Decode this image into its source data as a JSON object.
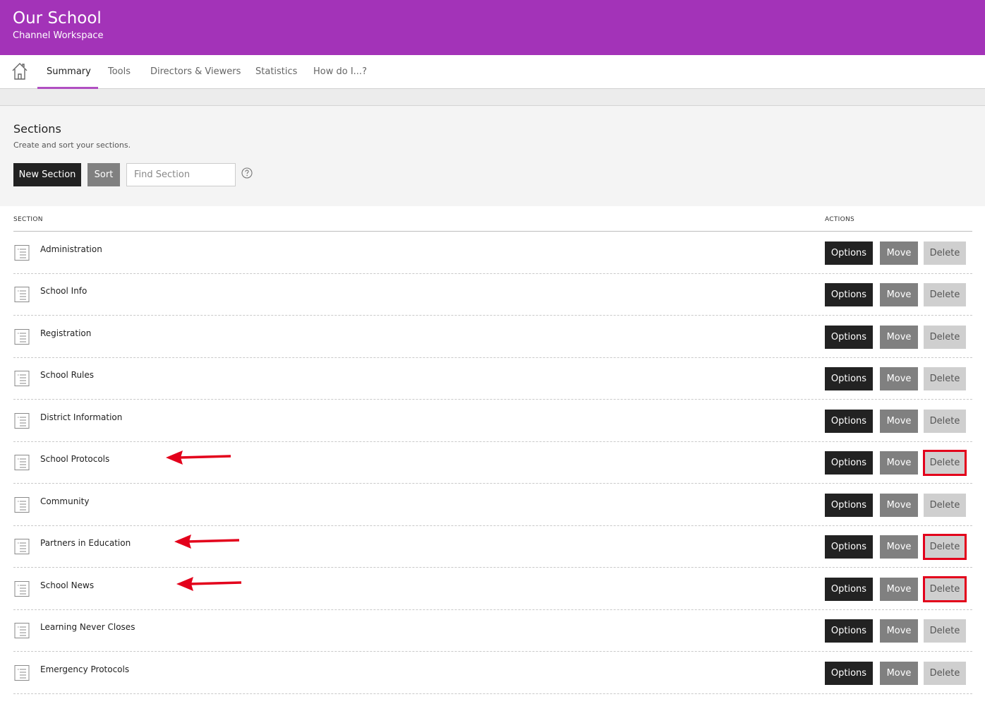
{
  "header": {
    "title": "Our School",
    "subtitle": "Channel Workspace",
    "color": "#a333b8"
  },
  "nav": {
    "home_icon": "home-icon",
    "tabs": [
      "Summary",
      "Tools",
      "Directors & Viewers",
      "Statistics",
      "How do I...?"
    ],
    "active_tab": "Summary"
  },
  "sections_panel": {
    "heading": "Sections",
    "description": "Create and sort your sections.",
    "new_section_label": "New Section",
    "sort_label": "Sort",
    "find_placeholder": "Find Section",
    "help_icon": "help-circle-icon"
  },
  "table": {
    "col_section": "SECTION",
    "col_actions": "ACTIONS",
    "row_icon": "section-page-icon",
    "options_label": "Options",
    "move_label": "Move",
    "delete_label": "Delete",
    "rows": [
      {
        "name": "Administration",
        "highlighted_delete": false,
        "annotated": false
      },
      {
        "name": "School Info",
        "highlighted_delete": false,
        "annotated": false
      },
      {
        "name": "Registration",
        "highlighted_delete": false,
        "annotated": false
      },
      {
        "name": "School Rules",
        "highlighted_delete": false,
        "annotated": false
      },
      {
        "name": "District Information",
        "highlighted_delete": false,
        "annotated": false
      },
      {
        "name": "School Protocols",
        "highlighted_delete": true,
        "annotated": true
      },
      {
        "name": "Community",
        "highlighted_delete": false,
        "annotated": false
      },
      {
        "name": "Partners in Education",
        "highlighted_delete": true,
        "annotated": true
      },
      {
        "name": "School News",
        "highlighted_delete": true,
        "annotated": true
      },
      {
        "name": "Learning Never Closes",
        "highlighted_delete": false,
        "annotated": false
      },
      {
        "name": "Emergency Protocols",
        "highlighted_delete": false,
        "annotated": false
      }
    ]
  },
  "annotation_color": "#e3001b"
}
